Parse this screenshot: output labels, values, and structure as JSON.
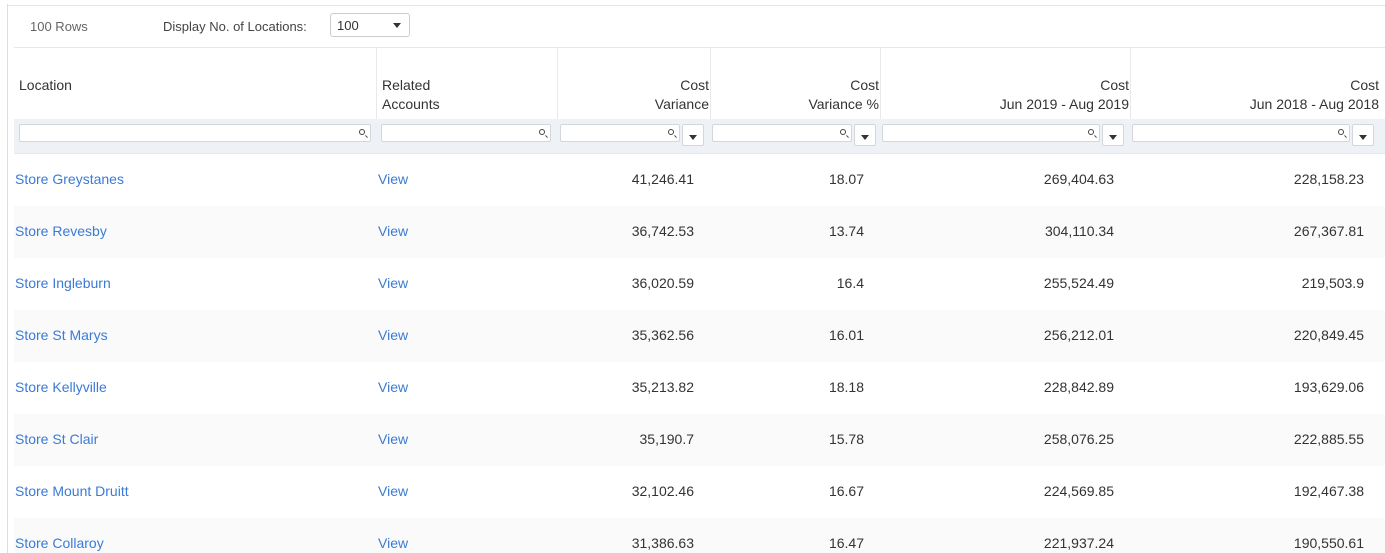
{
  "toolbar": {
    "row_count": "100 Rows",
    "display_label": "Display No. of Locations:",
    "display_value": "100"
  },
  "columns": [
    {
      "line1": "Location",
      "line2": ""
    },
    {
      "line1": "Related",
      "line2": "Accounts"
    },
    {
      "line1": "Cost",
      "line2": "Variance"
    },
    {
      "line1": "Cost",
      "line2": "Variance %"
    },
    {
      "line1": "Cost",
      "line2": "Jun 2019 - Aug 2019"
    },
    {
      "line1": "Cost",
      "line2": "Jun 2018 - Aug 2018"
    }
  ],
  "rows": [
    {
      "location": "Store Greystanes",
      "accounts": "View",
      "variance": "41,246.41",
      "variance_pct": "18.07",
      "cost_2019": "269,404.63",
      "cost_2018": "228,158.23"
    },
    {
      "location": "Store Revesby",
      "accounts": "View",
      "variance": "36,742.53",
      "variance_pct": "13.74",
      "cost_2019": "304,110.34",
      "cost_2018": "267,367.81"
    },
    {
      "location": "Store Ingleburn",
      "accounts": "View",
      "variance": "36,020.59",
      "variance_pct": "16.4",
      "cost_2019": "255,524.49",
      "cost_2018": "219,503.9"
    },
    {
      "location": "Store St Marys",
      "accounts": "View",
      "variance": "35,362.56",
      "variance_pct": "16.01",
      "cost_2019": "256,212.01",
      "cost_2018": "220,849.45"
    },
    {
      "location": "Store Kellyville",
      "accounts": "View",
      "variance": "35,213.82",
      "variance_pct": "18.18",
      "cost_2019": "228,842.89",
      "cost_2018": "193,629.06"
    },
    {
      "location": "Store St Clair",
      "accounts": "View",
      "variance": "35,190.7",
      "variance_pct": "15.78",
      "cost_2019": "258,076.25",
      "cost_2018": "222,885.55"
    },
    {
      "location": "Store Mount Druitt",
      "accounts": "View",
      "variance": "32,102.46",
      "variance_pct": "16.67",
      "cost_2019": "224,569.85",
      "cost_2018": "192,467.38"
    },
    {
      "location": "Store Collaroy",
      "accounts": "View",
      "variance": "31,386.63",
      "variance_pct": "16.47",
      "cost_2019": "221,937.24",
      "cost_2018": "190,550.61"
    }
  ]
}
